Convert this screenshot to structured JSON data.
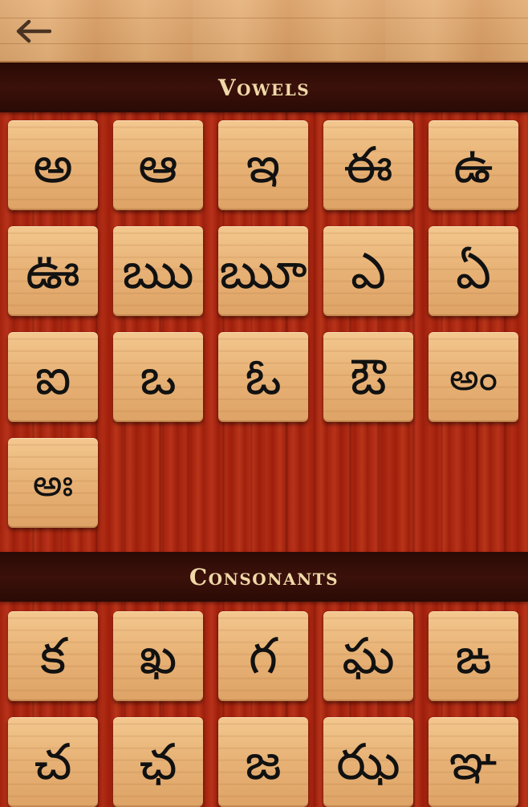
{
  "header": {
    "back_icon": "arrow-left-icon"
  },
  "vowels": {
    "title": "Vowels",
    "letters": [
      "అ",
      "ఆ",
      "ఇ",
      "ఈ",
      "ఉ",
      "ఊ",
      "ఋ",
      "ౠ",
      "ఎ",
      "ఏ",
      "ఐ",
      "ఒ",
      "ఓ",
      "ఔ",
      "అం",
      "అః"
    ]
  },
  "consonants": {
    "title": "Consonants",
    "letters": [
      "క",
      "ఖ",
      "గ",
      "ఘ",
      "ఙ",
      "చ",
      "ఛ",
      "జ",
      "ఝ",
      "ఞ"
    ]
  },
  "colors": {
    "header_bar": "#2a0a05",
    "title_text": "#f0d9a8",
    "tile": "#e8b377",
    "background": "#a82810"
  }
}
